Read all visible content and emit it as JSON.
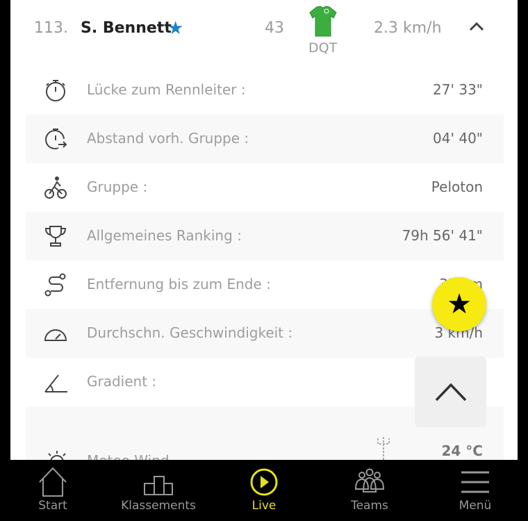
{
  "rider": {
    "rank": "113.",
    "name": "S. Bennett",
    "number": "43",
    "team": "DQT",
    "speed": "2.3 km/h",
    "favorite": true,
    "jersey_color": "#3cae3f"
  },
  "details": [
    {
      "icon": "stopwatch-icon",
      "label": "Lücke zum Rennleiter :",
      "value": "27' 33\""
    },
    {
      "icon": "stopwatch-arrow-icon",
      "label": "Abstand vorh. Gruppe :",
      "value": "04' 40\""
    },
    {
      "icon": "cyclists-icon",
      "label": "Gruppe :",
      "value": "Peloton"
    },
    {
      "icon": "trophy-icon",
      "label": "Allgemeines Ranking :",
      "value": "79h 56' 41\""
    },
    {
      "icon": "route-icon",
      "label": "Entfernung bis zum Ende :",
      "value": "33 km"
    },
    {
      "icon": "speedometer-icon",
      "label": "Durchschn. Geschwindigkeit :",
      "value": "3 km/h"
    },
    {
      "icon": "gradient-icon",
      "label": "Gradient :",
      "value": ""
    }
  ],
  "weather": {
    "label": "Meteo Wind",
    "temperature": "24 °C"
  },
  "nav": [
    {
      "label": "Start",
      "icon": "home-icon"
    },
    {
      "label": "Klassements",
      "icon": "podium-icon"
    },
    {
      "label": "Live",
      "icon": "play-icon",
      "active": true
    },
    {
      "label": "Teams",
      "icon": "team-icon"
    },
    {
      "label": "Menü",
      "icon": "menu-icon"
    }
  ],
  "colors": {
    "accent": "#e7e01a",
    "fab": "#f6ea10",
    "star": "#1b84c6"
  }
}
